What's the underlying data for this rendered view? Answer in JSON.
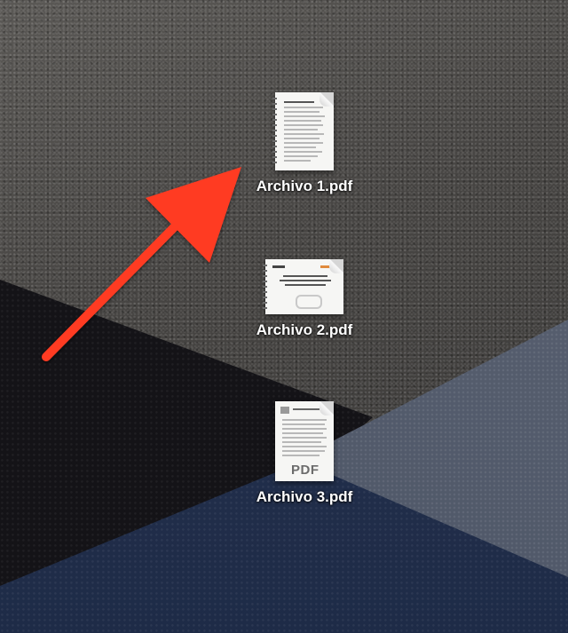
{
  "desktop": {
    "files": [
      {
        "label": "Archivo 1.pdf",
        "icon": "pdf-document-icon"
      },
      {
        "label": "Archivo 2.pdf",
        "icon": "pdf-document-icon"
      },
      {
        "label": "Archivo 3.pdf",
        "icon": "pdf-document-icon",
        "thumb_text": "PDF"
      }
    ]
  },
  "annotation": {
    "icon": "red-arrow-icon",
    "color": "#ff3b24"
  }
}
